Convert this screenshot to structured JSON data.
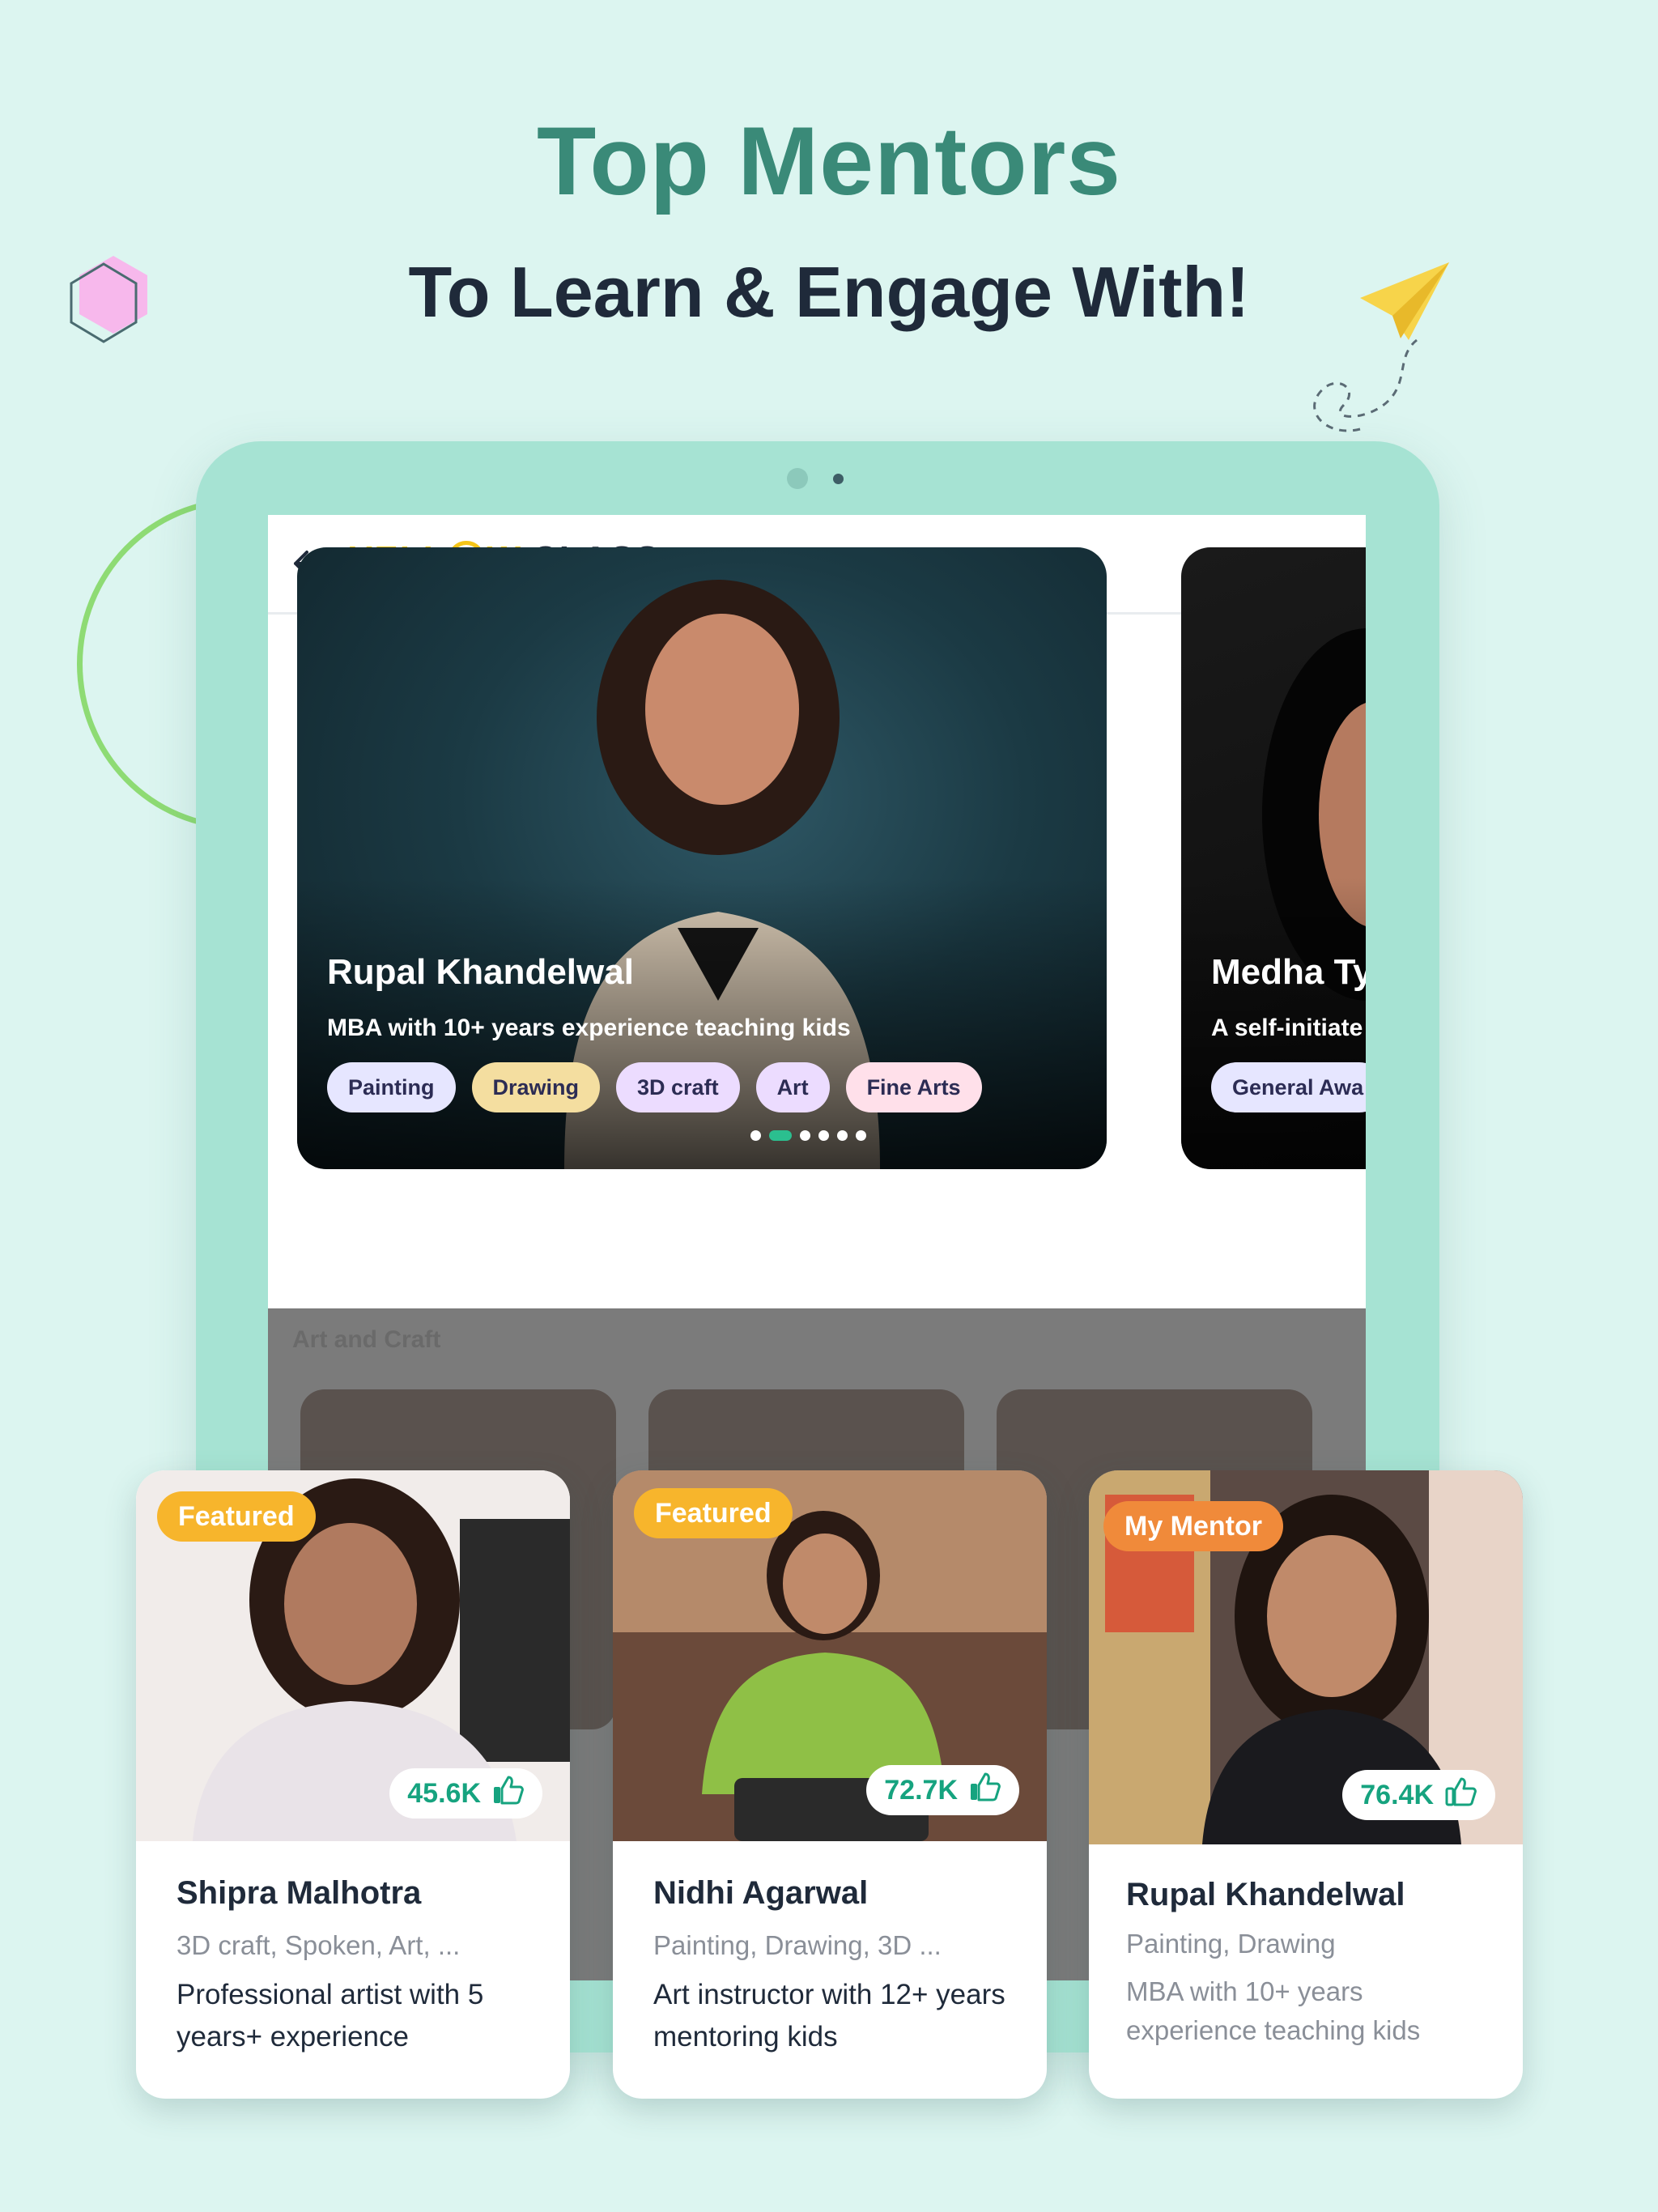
{
  "headline": {
    "title": "Top Mentors",
    "subtitle": "To Learn & Engage With!"
  },
  "app": {
    "logo_part1": "YELL",
    "logo_part2": "W",
    "logo_part3": "CLASS"
  },
  "carousel": {
    "slides": [
      {
        "name": "Rupal Khandelwal",
        "description": "MBA with 10+ years experience teaching kids",
        "chips": [
          {
            "label": "Painting",
            "color": "#e6e6ff"
          },
          {
            "label": "Drawing",
            "color": "#f4dea0"
          },
          {
            "label": "3D craft",
            "color": "#ecdcff"
          },
          {
            "label": "Art",
            "color": "#ecdcff"
          },
          {
            "label": "Fine Arts",
            "color": "#ffe0ea"
          }
        ]
      },
      {
        "name": "Medha Ty",
        "description": "A self-initiate",
        "chips": [
          {
            "label": "General Awa",
            "color": "#e6e6ff"
          }
        ]
      }
    ],
    "dots_count": 6,
    "active_dot": 1
  },
  "dimmed_section": {
    "title": "Art and Craft"
  },
  "mentor_cards": [
    {
      "badge": "Featured",
      "badge_color": "#f7b52c",
      "likes": "45.6K",
      "name": "Shipra Malhotra",
      "tags": "3D craft, Spoken, Art, ...",
      "description": "Professional artist with 5 years+ experience",
      "photo_bg": "#f1ecea",
      "liked": true
    },
    {
      "badge": "Featured",
      "badge_color": "#f7b52c",
      "likes": "72.7K",
      "name": "Nidhi Agarwal",
      "tags": "Painting, Drawing, 3D ...",
      "description": "Art instructor with 12+ years mentoring kids",
      "photo_bg": "#7a5a48",
      "liked": true
    },
    {
      "badge": "My Mentor",
      "badge_color": "#f08a3a",
      "likes": "76.4K",
      "name": "Rupal Khandelwal",
      "tags": "Painting, Drawing",
      "description": "MBA with 10+ years experience teaching kids",
      "photo_bg": "#5b4a44",
      "liked": false
    }
  ],
  "colors": {
    "background": "#dcf5f0",
    "title_green": "#3a8a78",
    "tablet_frame": "#a6e3d3",
    "accent_green": "#16a37f",
    "logo_yellow": "#f5c518"
  }
}
